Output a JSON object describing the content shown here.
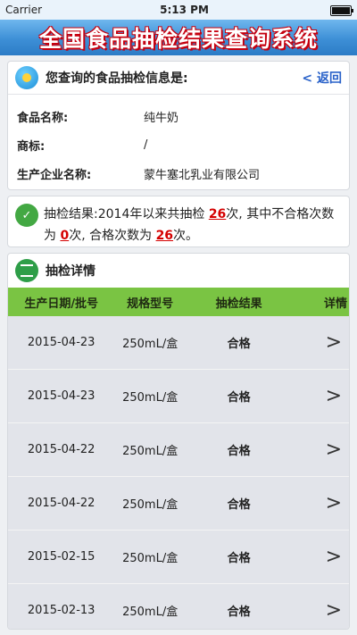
{
  "status_bar": {
    "carrier": "Carrier",
    "time": "5:13 PM"
  },
  "app_title": "全国食品抽检结果查询系统",
  "info_card": {
    "title": "您查询的食品抽检信息是:",
    "back_label": "< 返回",
    "fields": [
      {
        "label": "食品名称:",
        "value": "纯牛奶"
      },
      {
        "label": "商标:",
        "value": "/"
      },
      {
        "label": "生产企业名称:",
        "value": "蒙牛塞北乳业有限公司"
      }
    ]
  },
  "result_card": {
    "prefix": "抽检结果:",
    "text_1": "2014年以来共抽检 ",
    "total": "26",
    "text_2": "次, 其中不合格次数为 ",
    "failed": "0",
    "text_3": "次, 合格次数为 ",
    "passed": "26",
    "text_4": "次。"
  },
  "details_card": {
    "title": "抽检详情",
    "columns": [
      "生产日期/批号",
      "规格型号",
      "抽检结果",
      "详情"
    ],
    "rows": [
      {
        "date": "2015-04-23",
        "spec": "250mL/盒",
        "result": "合格",
        "detail": ">"
      },
      {
        "date": "2015-04-23",
        "spec": "250mL/盒",
        "result": "合格",
        "detail": ">"
      },
      {
        "date": "2015-04-22",
        "spec": "250mL/盒",
        "result": "合格",
        "detail": ">"
      },
      {
        "date": "2015-04-22",
        "spec": "250mL/盒",
        "result": "合格",
        "detail": ">"
      },
      {
        "date": "2015-02-15",
        "spec": "250mL/盒",
        "result": "合格",
        "detail": ">"
      },
      {
        "date": "2015-02-13",
        "spec": "250mL/盒",
        "result": "合格",
        "detail": ">"
      }
    ]
  }
}
